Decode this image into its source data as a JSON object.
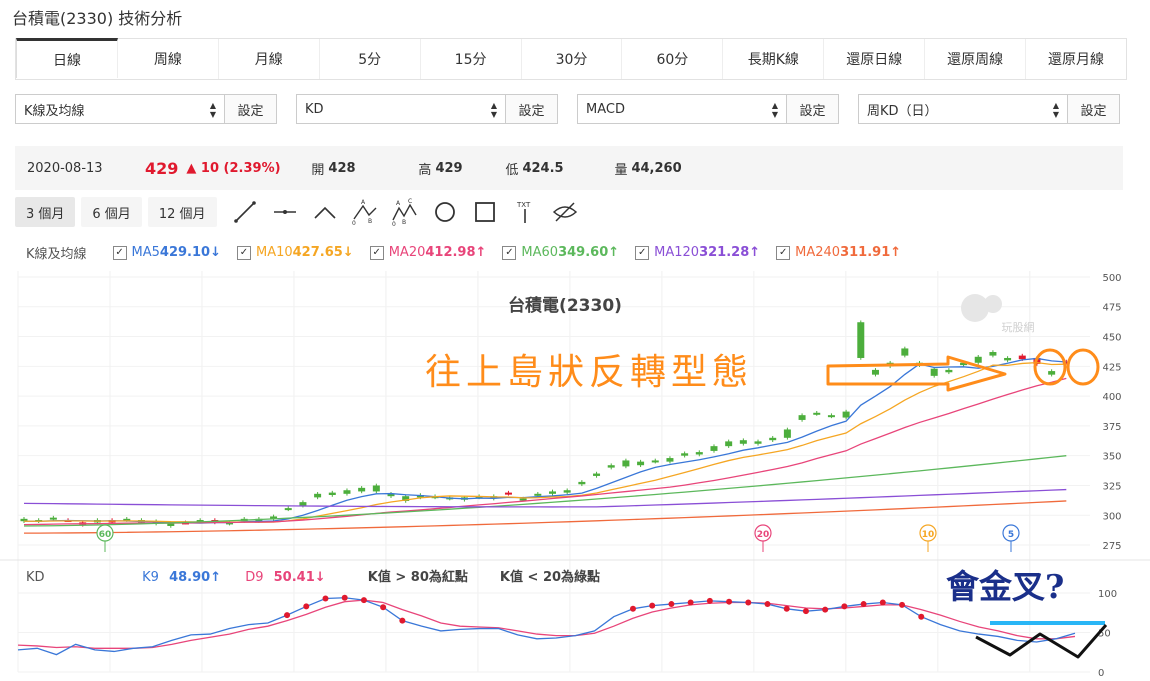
{
  "page_title": "台積電(2330) 技術分析",
  "tabs": [
    "日線",
    "周線",
    "月線",
    "5分",
    "15分",
    "30分",
    "60分",
    "長期K線",
    "還原日線",
    "還原周線",
    "還原月線"
  ],
  "active_tab": "日線",
  "selectors": [
    {
      "value": "K線及均線",
      "button": "設定"
    },
    {
      "value": "KD",
      "button": "設定"
    },
    {
      "value": "MACD",
      "button": "設定"
    },
    {
      "value": "周KD（日）",
      "button": "設定"
    }
  ],
  "quote": {
    "date": "2020-08-13",
    "price": "429",
    "change": "▲ 10 (2.39%)",
    "open_label": "開",
    "open": "428",
    "high_label": "高",
    "high": "429",
    "low_label": "低",
    "low": "424.5",
    "volume_label": "量",
    "volume": "44,260"
  },
  "range_buttons": [
    "3 個月",
    "6 個月",
    "12 個月"
  ],
  "active_range": "3 個月",
  "tool_icons": [
    "line-tool-icon",
    "segment-tool-icon",
    "wedge-tool-icon",
    "abc-pattern-icon",
    "abcd-pattern-icon",
    "circle-tool-icon",
    "rectangle-tool-icon",
    "text-tool-icon",
    "hide-drawings-icon"
  ],
  "ma_legend": {
    "title": "K線及均線",
    "items": [
      {
        "name": "MA5",
        "value": "429.10↓",
        "color": "#3a77d8"
      },
      {
        "name": "MA10",
        "value": "427.65↓",
        "color": "#f5a623"
      },
      {
        "name": "MA20",
        "value": "412.98↑",
        "color": "#e8457a"
      },
      {
        "name": "MA60",
        "value": "349.60↑",
        "color": "#5cb85c"
      },
      {
        "name": "MA120",
        "value": "321.28↑",
        "color": "#8a4fd6"
      },
      {
        "name": "MA240",
        "value": "311.91↑",
        "color": "#f06a3c"
      }
    ]
  },
  "kd_legend": {
    "title": "KD",
    "k_label": "K9",
    "k_value": "48.90↑",
    "d_label": "D9",
    "d_value": "50.41↓",
    "note1": "K值 > 80為紅點",
    "note2": "K值 < 20為綠點"
  },
  "annotations": {
    "pattern_text": "往上島狀反轉型態",
    "question_text": "會金叉?"
  },
  "watermark": "玩股網",
  "colors": {
    "up": "#e0192e",
    "down": "#4cae3c",
    "k_line": "#3a77d8",
    "d_line": "#e8457a",
    "annot_orange": "#ff8c1a",
    "annot_blue": "#1a2f8a"
  },
  "chart_data": {
    "type": "candlestick",
    "title": "台積電(2330)",
    "price_axis": {
      "ticks": [
        500,
        475,
        450,
        425,
        400,
        375,
        350,
        325,
        300,
        275
      ],
      "ylim": [
        270,
        505
      ]
    },
    "kd_axis": {
      "ticks": [
        100,
        50,
        0
      ],
      "ylim": [
        0,
        100
      ]
    },
    "candles": [
      {
        "o": 297,
        "c": 295
      },
      {
        "o": 296,
        "c": 295
      },
      {
        "o": 298,
        "c": 297
      },
      {
        "o": 296,
        "c": 296
      },
      {
        "o": 292,
        "c": 294
      },
      {
        "o": 296,
        "c": 294
      },
      {
        "o": 294,
        "c": 296
      },
      {
        "o": 297,
        "c": 296
      },
      {
        "o": 296,
        "c": 294
      },
      {
        "o": 295,
        "c": 293
      },
      {
        "o": 293,
        "c": 291
      },
      {
        "o": 294,
        "c": 294
      },
      {
        "o": 296,
        "c": 295
      },
      {
        "o": 294,
        "c": 296
      },
      {
        "o": 294,
        "c": 293
      },
      {
        "o": 297,
        "c": 295
      },
      {
        "o": 297,
        "c": 295
      },
      {
        "o": 299,
        "c": 297
      },
      {
        "o": 306,
        "c": 305
      },
      {
        "o": 311,
        "c": 308
      },
      {
        "o": 318,
        "c": 315
      },
      {
        "o": 319,
        "c": 317
      },
      {
        "o": 321,
        "c": 318
      },
      {
        "o": 323,
        "c": 320
      },
      {
        "o": 325,
        "c": 320
      },
      {
        "o": 318,
        "c": 316
      },
      {
        "o": 316,
        "c": 312
      },
      {
        "o": 317,
        "c": 315
      },
      {
        "o": 316,
        "c": 315
      },
      {
        "o": 315,
        "c": 314
      },
      {
        "o": 315,
        "c": 313
      },
      {
        "o": 316,
        "c": 315
      },
      {
        "o": 316,
        "c": 314
      },
      {
        "o": 318,
        "c": 319
      },
      {
        "o": 314,
        "c": 313
      },
      {
        "o": 318,
        "c": 317
      },
      {
        "o": 320,
        "c": 318
      },
      {
        "o": 321,
        "c": 319
      },
      {
        "o": 328,
        "c": 326
      },
      {
        "o": 335,
        "c": 333
      },
      {
        "o": 342,
        "c": 340
      },
      {
        "o": 346,
        "c": 341
      },
      {
        "o": 345,
        "c": 342
      },
      {
        "o": 346,
        "c": 345
      },
      {
        "o": 348,
        "c": 345
      },
      {
        "o": 352,
        "c": 350
      },
      {
        "o": 353,
        "c": 351
      },
      {
        "o": 358,
        "c": 354
      },
      {
        "o": 362,
        "c": 358
      },
      {
        "o": 363,
        "c": 360
      },
      {
        "o": 362,
        "c": 360
      },
      {
        "o": 365,
        "c": 363
      },
      {
        "o": 372,
        "c": 365
      },
      {
        "o": 384,
        "c": 380
      },
      {
        "o": 386,
        "c": 385
      },
      {
        "o": 384,
        "c": 383
      },
      {
        "o": 387,
        "c": 382
      },
      {
        "o": 462,
        "c": 432
      },
      {
        "o": 422,
        "c": 418
      },
      {
        "o": 428,
        "c": 425
      },
      {
        "o": 440,
        "c": 434
      },
      {
        "o": 428,
        "c": 426
      },
      {
        "o": 423,
        "c": 417
      },
      {
        "o": 422,
        "c": 420
      },
      {
        "o": 428,
        "c": 426
      },
      {
        "o": 433,
        "c": 428
      },
      {
        "o": 437,
        "c": 434
      },
      {
        "o": 432,
        "c": 430
      },
      {
        "o": 431,
        "c": 434
      },
      {
        "o": 427,
        "c": 432
      },
      {
        "o": 421,
        "c": 418
      },
      {
        "o": 428,
        "c": 429
      }
    ],
    "ma_markers": [
      {
        "label": "60"
      },
      {
        "label": "20"
      },
      {
        "label": "10"
      },
      {
        "label": "5"
      }
    ],
    "kd": {
      "k": [
        28,
        30,
        22,
        35,
        28,
        26,
        30,
        32,
        40,
        47,
        48,
        55,
        60,
        62,
        72,
        83,
        93,
        94,
        91,
        82,
        65,
        58,
        52,
        54,
        55,
        55,
        47,
        42,
        43,
        46,
        52,
        70,
        80,
        84,
        86,
        88,
        90,
        89,
        88,
        86,
        80,
        77,
        79,
        83,
        86,
        88,
        85,
        70,
        60,
        52,
        48,
        45,
        40,
        38,
        42,
        49
      ],
      "d": [
        34,
        33,
        31,
        32,
        30,
        30,
        30,
        31,
        35,
        40,
        44,
        48,
        54,
        58,
        65,
        73,
        82,
        89,
        91,
        88,
        79,
        71,
        62,
        58,
        57,
        56,
        52,
        48,
        46,
        46,
        49,
        58,
        68,
        76,
        81,
        85,
        87,
        88,
        88,
        87,
        84,
        81,
        80,
        81,
        83,
        85,
        85,
        79,
        72,
        64,
        57,
        52,
        46,
        42,
        42,
        45
      ],
      "red_dots": [
        14,
        15,
        16,
        17,
        18,
        19,
        20,
        32,
        33,
        34,
        35,
        36,
        37,
        38,
        39,
        40,
        41,
        42,
        43,
        44,
        45,
        46,
        47
      ]
    }
  }
}
